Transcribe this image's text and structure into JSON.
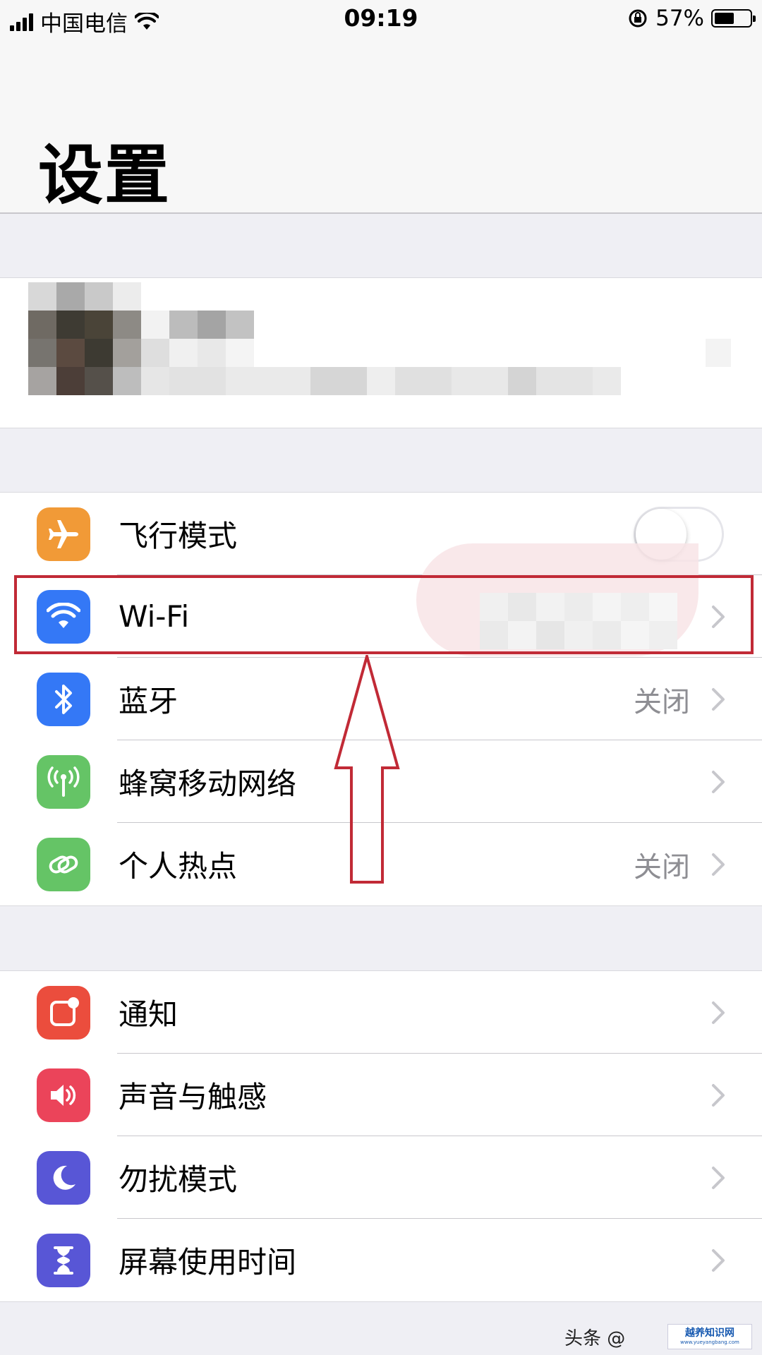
{
  "status_bar": {
    "carrier": "中国电信",
    "time": "09:19",
    "battery_percent": "57%",
    "battery_level": 0.57,
    "icons": [
      "signal-icon",
      "wifi-icon",
      "rotation-lock-icon",
      "battery-icon"
    ]
  },
  "header": {
    "title": "设置"
  },
  "section1": {
    "items": [
      {
        "label": "飞行模式",
        "icon": "airplane-icon",
        "color": "#f19a37",
        "toggle_on": false
      },
      {
        "label": "Wi-Fi",
        "icon": "wifi-icon",
        "color": "#3478f6",
        "value": ""
      },
      {
        "label": "蓝牙",
        "icon": "bluetooth-icon",
        "color": "#3478f6",
        "value": "关闭"
      },
      {
        "label": "蜂窝移动网络",
        "icon": "cellular-antenna-icon",
        "color": "#65c466",
        "value": ""
      },
      {
        "label": "个人热点",
        "icon": "hotspot-chain-icon",
        "color": "#65c466",
        "value": "关闭"
      }
    ]
  },
  "section2": {
    "items": [
      {
        "label": "通知",
        "icon": "notifications-icon",
        "color": "#eb4d3d"
      },
      {
        "label": "声音与触感",
        "icon": "speaker-icon",
        "color": "#eb445a"
      },
      {
        "label": "勿扰模式",
        "icon": "moon-icon",
        "color": "#5856d6"
      },
      {
        "label": "屏幕使用时间",
        "icon": "hourglass-icon",
        "color": "#5856d6"
      }
    ]
  },
  "annotation": {
    "highlight_color": "#c12a36"
  },
  "watermark": {
    "text": "头条 @",
    "logo_main": "越养知识网",
    "logo_sub": "www.yueyangbang.com"
  }
}
